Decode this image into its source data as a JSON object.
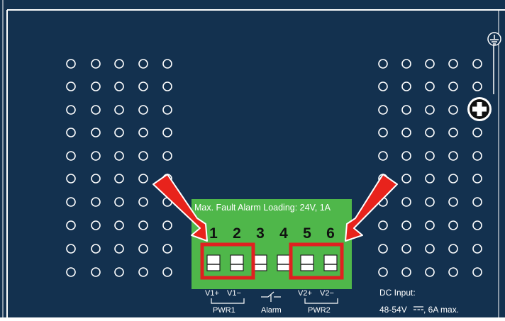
{
  "panel": {
    "background_color": "#13314f",
    "outline_color": "#ffffff",
    "vent_hole_color": "#ffffff"
  },
  "terminal_block": {
    "color": "#4fb74a",
    "caption": "Max. Fault Alarm Loading: 24V, 1A",
    "pins": [
      {
        "number": "1",
        "highlighted": true
      },
      {
        "number": "2",
        "highlighted": true
      },
      {
        "number": "3",
        "highlighted": false
      },
      {
        "number": "4",
        "highlighted": false
      },
      {
        "number": "5",
        "highlighted": true
      },
      {
        "number": "6",
        "highlighted": true
      }
    ],
    "highlight_color": "#e02020"
  },
  "pin_labels": {
    "v1_plus": "V1+",
    "v1_minus": "V1−",
    "v2_plus": "V2+",
    "v2_minus": "V2−",
    "pwr1": "PWR1",
    "alarm": "Alarm",
    "pwr2": "PWR2"
  },
  "dc_input": {
    "line1": "DC Input:",
    "voltage": "48-54V",
    "current": ", 6A max."
  },
  "arrows": {
    "color": "#e8231c",
    "outline": "#ffffff",
    "icon": "red-arrow-icon"
  },
  "icons": {
    "ground": "ground-icon",
    "screw": "ground-screw-icon"
  }
}
